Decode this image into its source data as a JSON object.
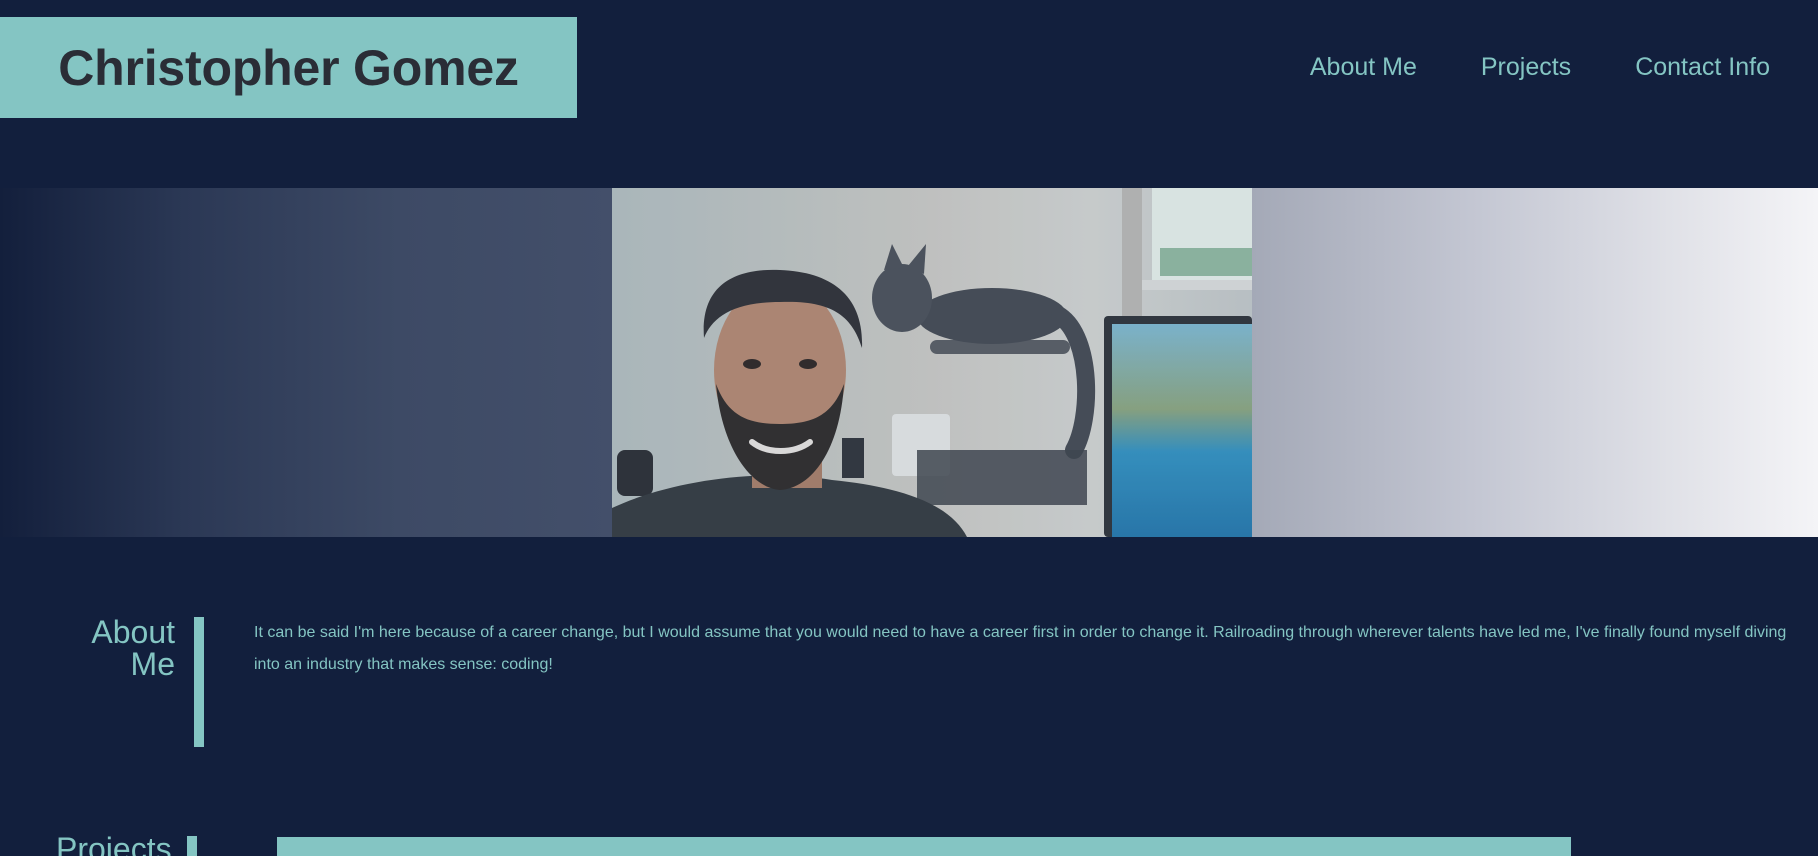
{
  "header": {
    "name": "Christopher Gomez",
    "nav": [
      "About Me",
      "Projects",
      "Contact Info"
    ]
  },
  "about": {
    "heading_line1": "About",
    "heading_line2": "Me",
    "text": "It can be said I'm here because of a career change, but I would assume that you would need to have a career first in order to change it. Railroading through wherever talents have led me, I've finally found myself diving into an industry that makes sense: coding!"
  },
  "projects": {
    "heading": "Projects"
  },
  "colors": {
    "background": "#121f3d",
    "accent": "#84c5c3",
    "name_text": "#2a2d36"
  }
}
